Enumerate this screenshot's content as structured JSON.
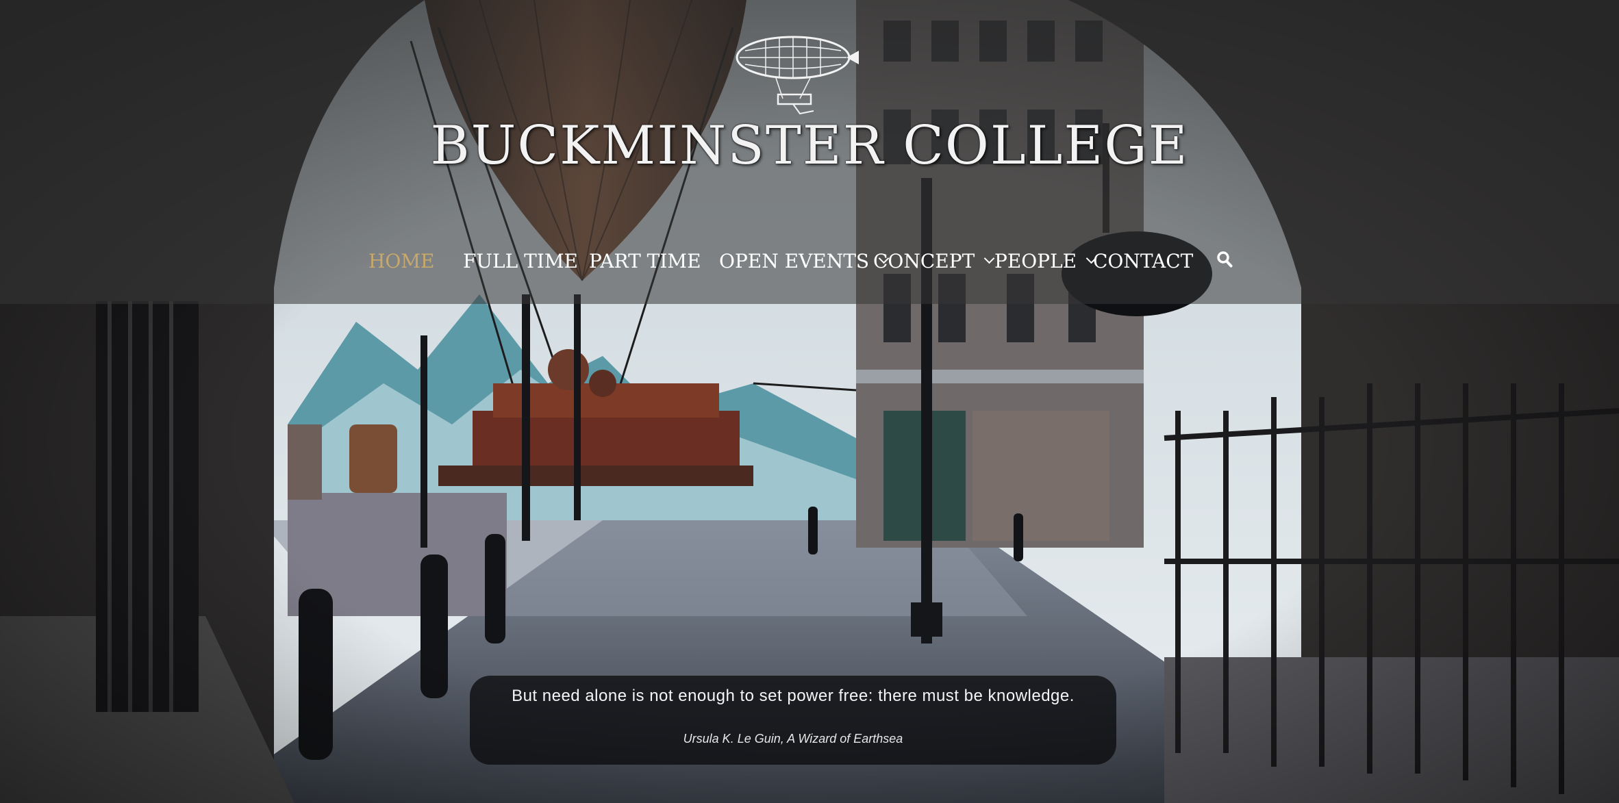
{
  "site": {
    "title": "BUCKMINSTER COLLEGE",
    "logo_icon": "airship-logo-icon"
  },
  "nav": {
    "items": [
      {
        "label": "HOME",
        "active": true,
        "has_dropdown": false
      },
      {
        "label": "FULL TIME",
        "active": false,
        "has_dropdown": false
      },
      {
        "label": "PART TIME",
        "active": false,
        "has_dropdown": false
      },
      {
        "label": "OPEN EVENTS",
        "active": false,
        "has_dropdown": true
      },
      {
        "label": "CONCEPT",
        "active": false,
        "has_dropdown": true
      },
      {
        "label": "PEOPLE",
        "active": false,
        "has_dropdown": true
      },
      {
        "label": "CONTACT",
        "active": false,
        "has_dropdown": false
      }
    ],
    "search_icon": "search-icon"
  },
  "quote": {
    "text": "But need alone is not enough to set power free: there must be knowledge.",
    "citation": "Ursula K. Le Guin, A Wizard of Earthsea"
  },
  "colors": {
    "active_nav": "#c7a86d",
    "nav_text": "#ffffff",
    "header_overlay": "rgba(55,55,55,0.55)",
    "quote_bg": "rgba(12,12,14,0.78)"
  }
}
